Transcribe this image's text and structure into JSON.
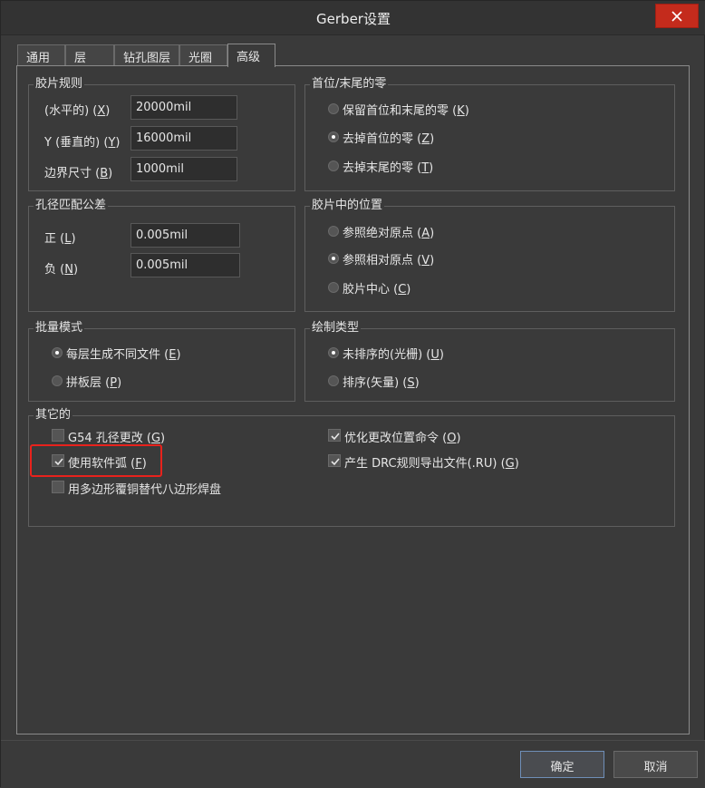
{
  "window": {
    "title": "Gerber设置"
  },
  "tabs": [
    {
      "label": "通用"
    },
    {
      "label": "层"
    },
    {
      "label": "钻孔图层"
    },
    {
      "label": "光圈"
    },
    {
      "label": "高级",
      "active": true
    }
  ],
  "film_rules": {
    "title": "胶片规则",
    "rows": [
      {
        "label": "(水平的) ",
        "key": "X",
        "value": "20000mil"
      },
      {
        "label": "Y (垂直的) ",
        "key": "Y",
        "value": "16000mil"
      },
      {
        "label": "边界尺寸 ",
        "key": "B",
        "value": "1000mil"
      }
    ]
  },
  "leading_trailing_zeros": {
    "title": "首位/末尾的零",
    "options": [
      {
        "label": "保留首位和末尾的零 ",
        "key": "K",
        "selected": false
      },
      {
        "label": "去掉首位的零 ",
        "key": "Z",
        "selected": true
      },
      {
        "label": "去掉末尾的零 ",
        "key": "T",
        "selected": false
      }
    ]
  },
  "aperture_tolerance": {
    "title": "孔径匹配公差",
    "rows": [
      {
        "label": "正 ",
        "key": "L",
        "value": "0.005mil"
      },
      {
        "label": "负 ",
        "key": "N",
        "value": "0.005mil"
      }
    ]
  },
  "film_position": {
    "title": "胶片中的位置",
    "options": [
      {
        "label": "参照绝对原点 ",
        "key": "A",
        "selected": false
      },
      {
        "label": "参照相对原点 ",
        "key": "V",
        "selected": true
      },
      {
        "label": "胶片中心 ",
        "key": "C",
        "selected": false
      }
    ]
  },
  "batch_mode": {
    "title": "批量模式",
    "options": [
      {
        "label": "每层生成不同文件 ",
        "key": "E",
        "selected": true
      },
      {
        "label": "拼板层 ",
        "key": "P",
        "selected": false
      }
    ]
  },
  "plot_type": {
    "title": "绘制类型",
    "options": [
      {
        "label": "未排序的(光栅) ",
        "key": "U",
        "selected": true
      },
      {
        "label": "排序(矢量) ",
        "key": "S",
        "selected": false
      }
    ]
  },
  "other": {
    "title": "其它的",
    "left": [
      {
        "label": "G54 孔径更改 ",
        "key": "G",
        "checked": false
      },
      {
        "label": "使用软件弧 ",
        "key": "F",
        "checked": true
      },
      {
        "label": "用多边形覆铜替代八边形焊盘",
        "key": "",
        "checked": false
      }
    ],
    "right": [
      {
        "label": "优化更改位置命令 ",
        "key": "O",
        "checked": true
      },
      {
        "label": "产生 DRC规则导出文件(.RU) ",
        "key": "G",
        "checked": true
      }
    ]
  },
  "footer": {
    "ok_label": "确定",
    "cancel_label": "取消"
  },
  "colors": {
    "highlight": "#e8221c",
    "close": "#c42b1c"
  }
}
